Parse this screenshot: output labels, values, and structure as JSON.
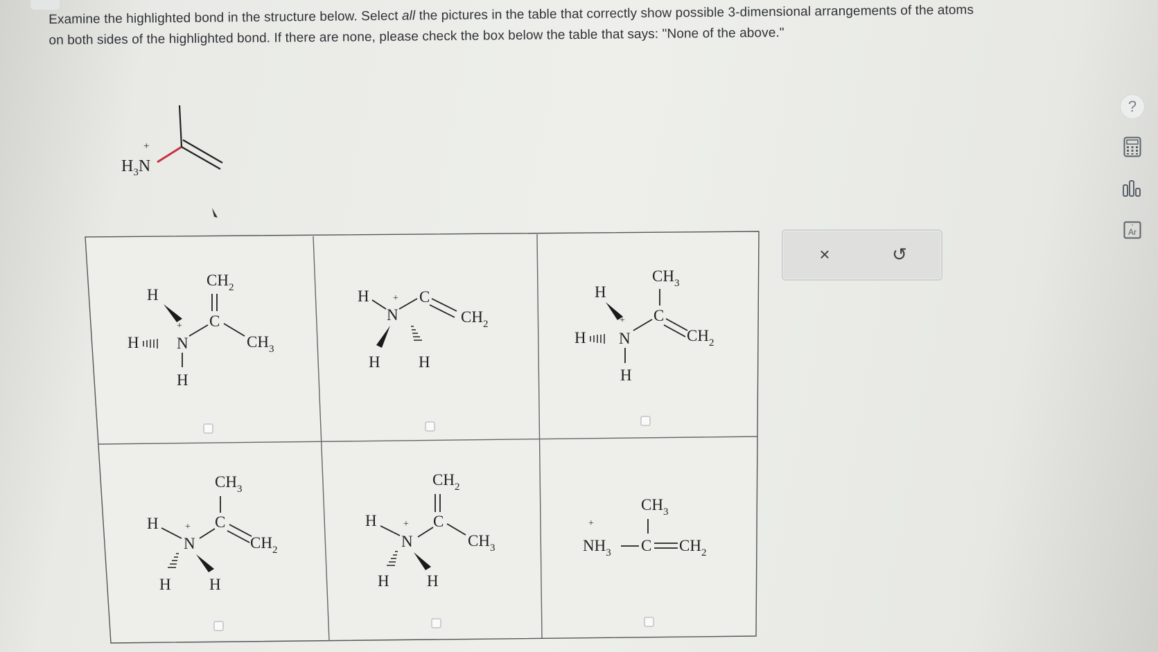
{
  "question": {
    "line1_before": "Examine the highlighted bond in the structure below. Select ",
    "line1_em": "all",
    "line1_after": " the pictures in the table that correctly show possible 3-dimensional arrangements of the atoms",
    "line2": "on both sides of the highlighted bond. If there are none, please check the box below the table that says: \"None of the above.\""
  },
  "molecule": {
    "plus": "+",
    "atom": "H",
    "sub": "3",
    "atom2": "N"
  },
  "labels": {
    "H": "H",
    "N": "N",
    "C": "C",
    "CH": "CH",
    "NH": "NH",
    "two": "2",
    "three": "3",
    "plus": "+",
    "eq": "="
  },
  "panel": {
    "clear_label": "×",
    "undo_label": "↺"
  },
  "tools": {
    "help_label": "?",
    "calculator": "calculator-icon",
    "chart": "bar-chart-icon",
    "periodic": "periodic-table-icon",
    "periodic_text": "Ar"
  },
  "colors": {
    "highlight_bond": "#c9303f",
    "ink": "#222222"
  },
  "options": [
    {
      "id": 1,
      "checked": false
    },
    {
      "id": 2,
      "checked": false
    },
    {
      "id": 3,
      "checked": false
    },
    {
      "id": 4,
      "checked": false
    },
    {
      "id": 5,
      "checked": false
    },
    {
      "id": 6,
      "checked": false
    }
  ]
}
